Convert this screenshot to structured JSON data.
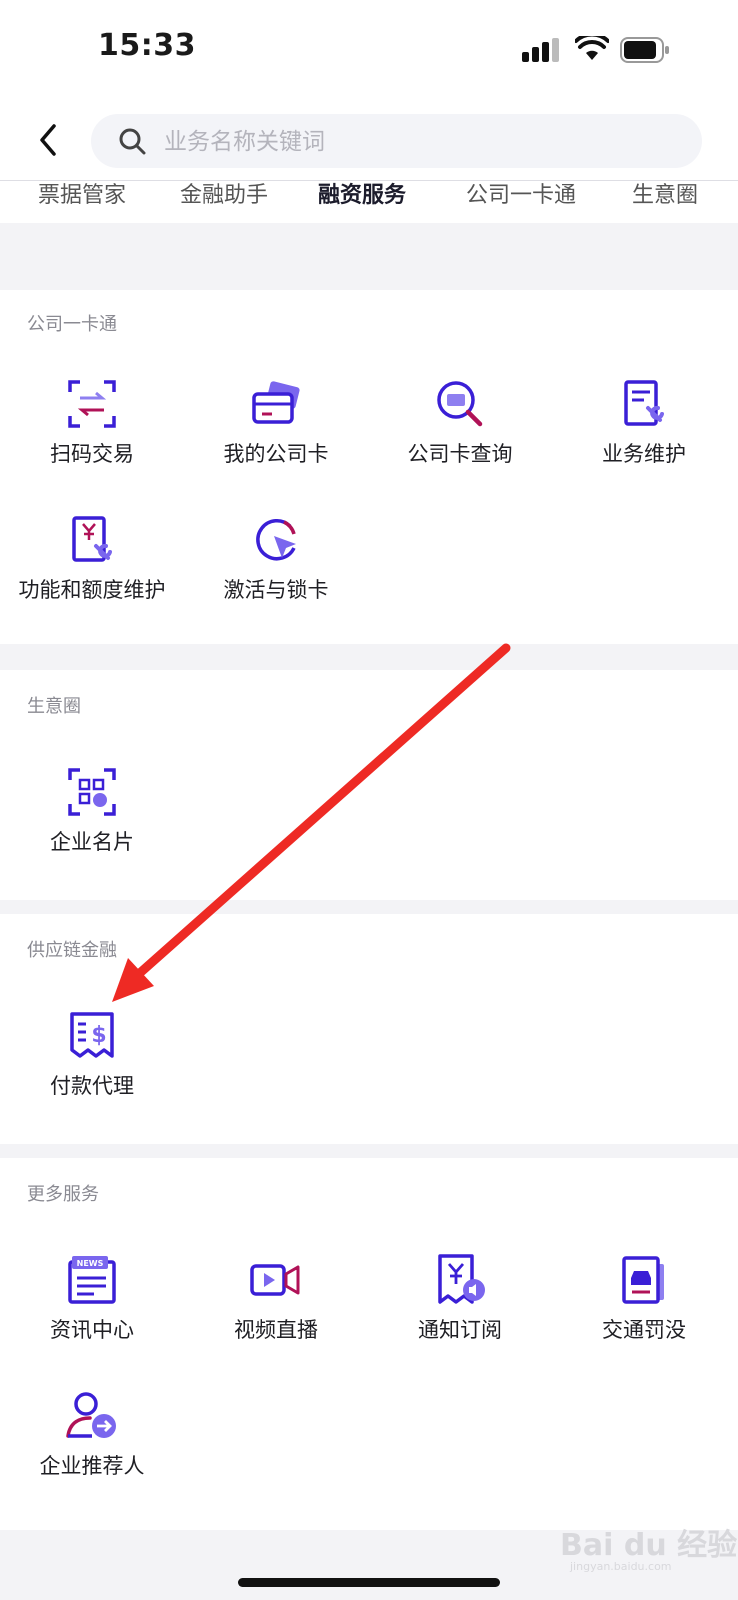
{
  "status": {
    "time": "15:33"
  },
  "search": {
    "placeholder": "业务名称关键词"
  },
  "tabs": [
    {
      "label": "票据管家"
    },
    {
      "label": "金融助手"
    },
    {
      "label": "融资服务"
    },
    {
      "label": "公司一卡通"
    },
    {
      "label": "生意圈"
    }
  ],
  "sections": {
    "card": {
      "title": "公司一卡通",
      "items": [
        {
          "label": "扫码交易",
          "icon": "scan-transfer-icon"
        },
        {
          "label": "我的公司卡",
          "icon": "company-card-icon"
        },
        {
          "label": "公司卡查询",
          "icon": "card-search-icon"
        },
        {
          "label": "业务维护",
          "icon": "document-wrench-icon"
        },
        {
          "label": "功能和额度维护",
          "icon": "yuan-document-wrench-icon"
        },
        {
          "label": "激活与锁卡",
          "icon": "activate-pointer-icon"
        }
      ]
    },
    "biz": {
      "title": "生意圈",
      "items": [
        {
          "label": "企业名片",
          "icon": "qr-card-icon"
        }
      ]
    },
    "supply": {
      "title": "供应链金融",
      "items": [
        {
          "label": "付款代理",
          "icon": "dollar-receipt-icon"
        }
      ]
    },
    "more": {
      "title": "更多服务",
      "items": [
        {
          "label": "资讯中心",
          "icon": "news-icon",
          "badge": "NEWS"
        },
        {
          "label": "视频直播",
          "icon": "video-live-icon"
        },
        {
          "label": "通知订阅",
          "icon": "notice-subscribe-icon"
        },
        {
          "label": "交通罚没",
          "icon": "traffic-fine-icon"
        },
        {
          "label": "企业推荐人",
          "icon": "referrer-icon"
        }
      ]
    }
  },
  "watermark": {
    "main": "Bai du 经验",
    "sub": "jingyan.baidu.com"
  },
  "colors": {
    "accent": "#3a1fd6",
    "accent2": "#b01257",
    "arrow": "#ee2a24"
  }
}
